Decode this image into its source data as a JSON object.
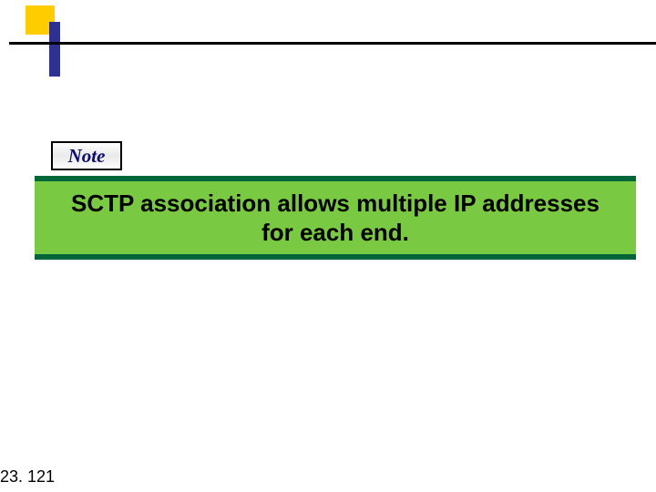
{
  "note_label": "Note",
  "callout_text": "SCTP association allows multiple IP addresses for each end.",
  "page_number": "23. 121"
}
